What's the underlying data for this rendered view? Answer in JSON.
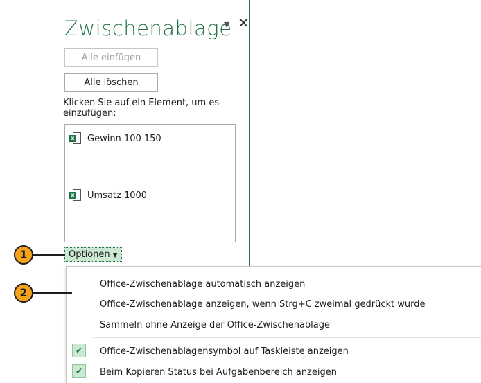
{
  "pane": {
    "title": "Zwischenablage",
    "menu_icon": "triangle-down-icon",
    "close_icon": "close-icon",
    "paste_all_label": "Alle einfügen",
    "clear_all_label": "Alle löschen",
    "hint": "Klicken Sie auf ein Element, um es einzufügen:",
    "items": [
      {
        "label": "Gewinn 100 150",
        "icon": "excel-icon"
      },
      {
        "label": "Umsatz 1000",
        "icon": "excel-icon"
      }
    ],
    "options_label": "Optionen"
  },
  "callouts": [
    "1",
    "2"
  ],
  "menu": {
    "items": [
      {
        "label": "Office-Zwischenablage automatisch anzeigen",
        "checked": false
      },
      {
        "label": "Office-Zwischenablage anzeigen, wenn Strg+C zweimal gedrückt wurde",
        "checked": false
      },
      {
        "label": "Sammeln ohne Anzeige der Office-Zwischenablage",
        "checked": false
      },
      {
        "label": "Office-Zwischenablagensymbol auf Taskleiste anzeigen",
        "checked": true
      },
      {
        "label": "Beim Kopieren Status bei Aufgabenbereich anzeigen",
        "checked": true
      }
    ]
  },
  "colors": {
    "accent": "#217346",
    "callout": "#f7a21b",
    "selected_bg": "#cce8d2"
  }
}
